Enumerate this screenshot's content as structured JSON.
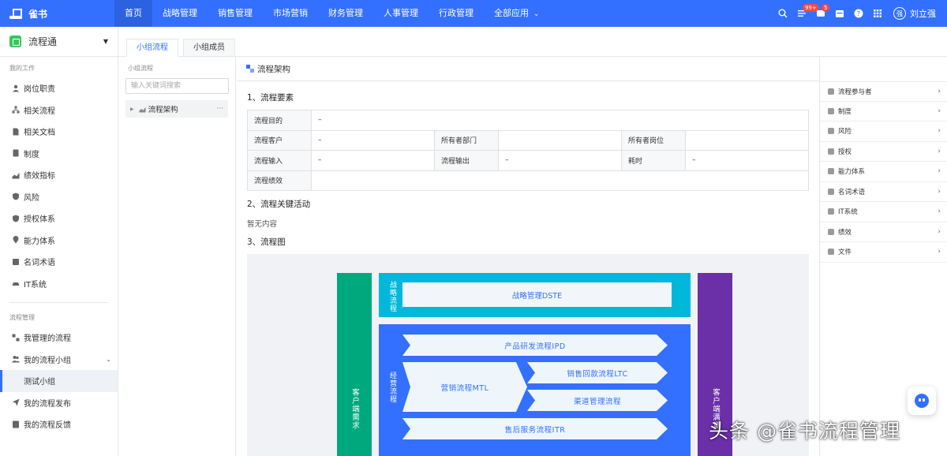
{
  "topbar": {
    "brand": "雀书",
    "nav": [
      "首页",
      "战略管理",
      "销售管理",
      "市场营销",
      "财务管理",
      "人事管理",
      "行政管理",
      "全部应用"
    ],
    "badges": {
      "todo": "99+",
      "msg": "5"
    },
    "user": {
      "avatar": "强",
      "name": "刘立强"
    },
    "accent": "#3370ff"
  },
  "sidebar": {
    "app": "流程通",
    "section_work": "我的工作",
    "work_items": [
      "岗位职责",
      "相关流程",
      "相关文档",
      "制度",
      "绩效指标",
      "风险",
      "授权体系",
      "能力体系",
      "名词术语",
      "IT系统"
    ],
    "section_manage": "流程管理",
    "manage_items": [
      "我管理的流程",
      "我的流程小组",
      "测试小组",
      "我的流程发布",
      "我的流程反馈"
    ]
  },
  "tabs": [
    "小组流程",
    "小组成员"
  ],
  "group_panel": {
    "title": "小组流程",
    "search_placeholder": "输入关键词搜索",
    "tree_item": "流程架构",
    "more": "···"
  },
  "main": {
    "title": "流程架构",
    "sec1": "1、流程要素",
    "rows": {
      "purpose": {
        "label": "流程目的",
        "value": "–"
      },
      "customer": {
        "label": "流程客户",
        "value": "–"
      },
      "owner_dept": {
        "label": "所有者部门",
        "value": ""
      },
      "owner_post": {
        "label": "所有者岗位",
        "value": ""
      },
      "input": {
        "label": "流程输入",
        "value": "–"
      },
      "output": {
        "label": "流程输出",
        "value": "–"
      },
      "time": {
        "label": "耗时",
        "value": "–"
      },
      "perf": {
        "label": "流程绩效",
        "value": ""
      }
    },
    "sec2": "2、流程关键活动",
    "empty": "暂无内容",
    "sec3": "3、流程图",
    "flow": {
      "left": "客户端需求",
      "right": "客户端满意",
      "strategy_label": "战略流程",
      "strategy_box": "战略管理DSTE",
      "ops_label": "经营流程",
      "ipd": "产品研发流程IPD",
      "mtl": "营销流程MTL",
      "ltc": "销售回款流程LTC",
      "channel": "渠道管理流程",
      "itr": "售后服务流程ITR"
    }
  },
  "right_panel": [
    "流程参与者",
    "制度",
    "风险",
    "授权",
    "能力体系",
    "名词术语",
    "IT系统",
    "绩效",
    "文件"
  ],
  "watermark": "头条 @雀书流程管理"
}
